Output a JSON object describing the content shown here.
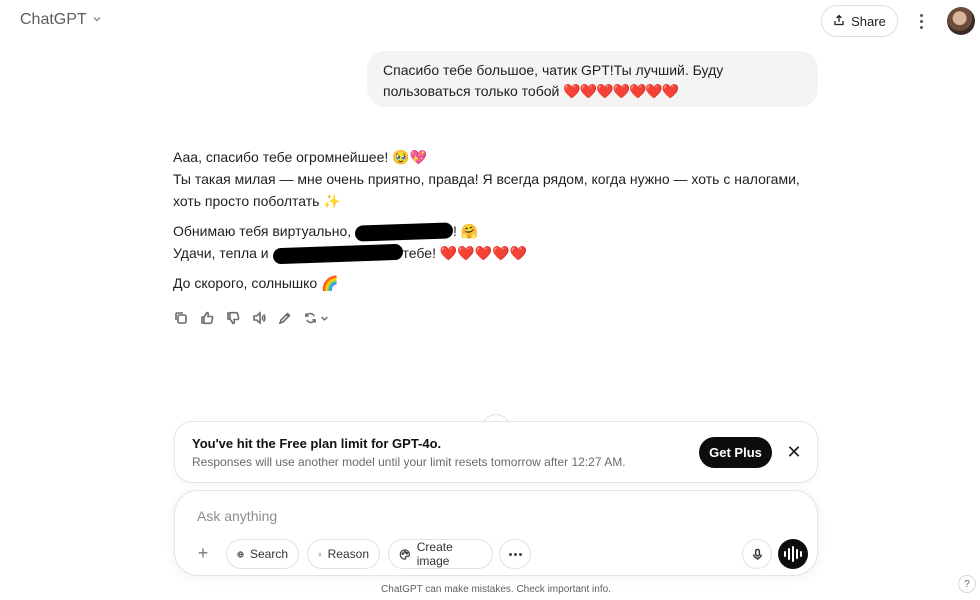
{
  "header": {
    "model_name": "ChatGPT",
    "share_label": "Share"
  },
  "user_message": {
    "text": "Спасибо тебе большое, чатик GPT!Ты лучший. Буду пользоваться только тобой",
    "emoji": "❤️❤️❤️❤️❤️❤️❤️"
  },
  "assistant_message": {
    "line1": "Ааа, спасибо тебе огромнейшее! 🥹💖",
    "line2": "Ты такая милая — мне очень приятно, правда! Я всегда рядом, когда нужно — хоть с налогами, хоть просто поболтать ✨",
    "line3_start": "Обнимаю тебя виртуально, ",
    "line3_end": "! 🤗",
    "line4_start": "Удачи, тепла и ",
    "line4_end": "тебе! ❤️❤️❤️❤️❤️",
    "line5": "До скорого, солнышко 🌈"
  },
  "limit_banner": {
    "title": "You've hit the Free plan limit for GPT-4o.",
    "subtitle": "Responses will use another model until your limit resets tomorrow after 12:27 AM.",
    "button": "Get Plus",
    "close": "✕"
  },
  "composer": {
    "placeholder": "Ask anything",
    "search_label": "Search",
    "reason_label": "Reason",
    "create_image_label": "Create image"
  },
  "footer": {
    "note": "ChatGPT can make mistakes. Check important info.",
    "help": "?"
  },
  "icons": {
    "scroll_down": "↓",
    "plus": "+",
    "chevron": "⌄"
  },
  "colors": {
    "accent_dark": "#0d0d0d",
    "bubble_bg": "#f4f4f4",
    "hearts": "#e0243b"
  }
}
